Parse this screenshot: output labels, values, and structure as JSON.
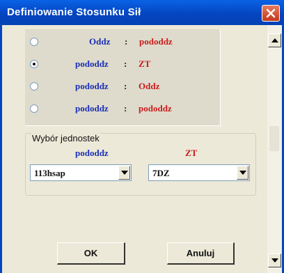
{
  "window": {
    "title": "Definiowanie Stosunku Sił"
  },
  "ratios": [
    {
      "left": "Oddz",
      "sep": ":",
      "right": "pododdz",
      "left_color": "#1b2fb5",
      "right_color": "#c81d1d",
      "selected": false
    },
    {
      "left": "pododdz",
      "sep": ":",
      "right": "ZT",
      "left_color": "#1b2fb5",
      "right_color": "#c81d1d",
      "selected": true
    },
    {
      "left": "pododdz",
      "sep": ":",
      "right": "Oddz",
      "left_color": "#1b2fb5",
      "right_color": "#c81d1d",
      "selected": false
    },
    {
      "left": "pododdz",
      "sep": ":",
      "right": "pododdz",
      "left_color": "#1b2fb5",
      "right_color": "#c81d1d",
      "selected": false
    }
  ],
  "units": {
    "group_label": "Wybór jednostek",
    "left_label": "pododdz",
    "right_label": "ZT",
    "left_value": "113hsap",
    "right_value": "7DZ"
  },
  "buttons": {
    "ok": "OK",
    "cancel": "Anuluj"
  },
  "icons": {
    "close": "close-icon",
    "dropdown": "chevron-down-icon",
    "scroll_up": "arrow-up-icon",
    "scroll_down": "arrow-down-icon"
  }
}
